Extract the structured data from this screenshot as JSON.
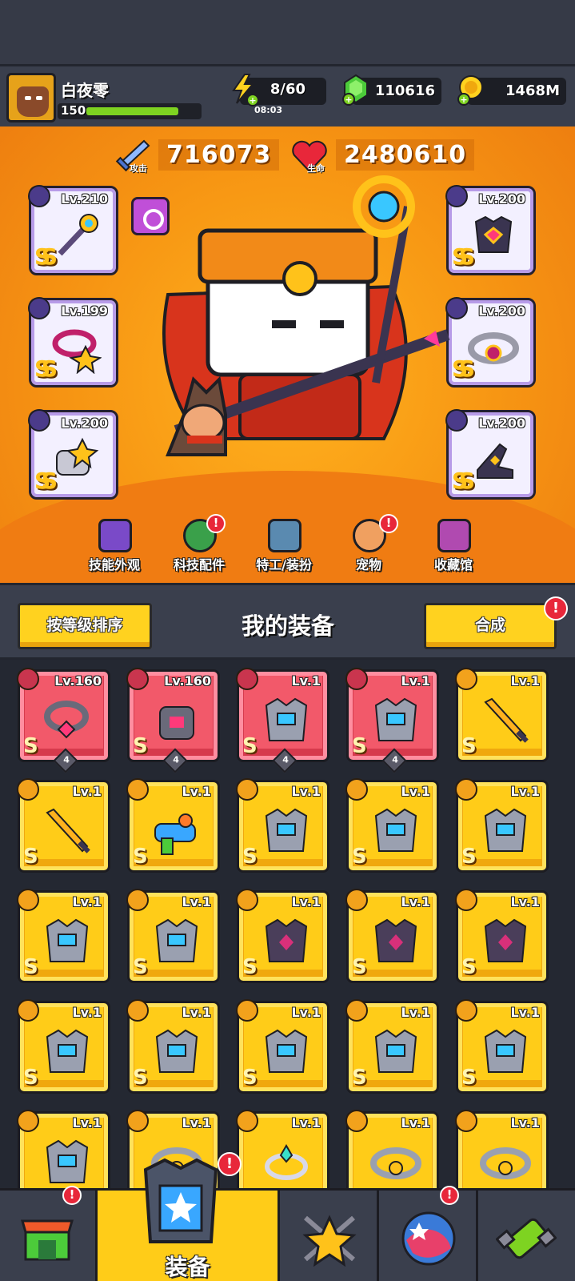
{
  "player": {
    "name": "白夜零",
    "level": "150",
    "xp_fraction": 0.82
  },
  "resources": {
    "energy": "8/60",
    "energy_timer": "08:03",
    "gems": "110616",
    "coins": "1468M"
  },
  "stats": {
    "attack_value": "716073",
    "attack_label": "攻击",
    "hp_value": "2480610",
    "hp_label": "生命"
  },
  "equipped": {
    "left": [
      {
        "level": "Lv.210",
        "rank": "SS",
        "icon": "staff-icon"
      },
      {
        "level": "Lv.199",
        "rank": "SS",
        "icon": "necklace-icon"
      },
      {
        "level": "Lv.200",
        "rank": "SS",
        "icon": "glove-icon"
      }
    ],
    "right": [
      {
        "level": "Lv.200",
        "rank": "SS",
        "icon": "armor-icon"
      },
      {
        "level": "Lv.200",
        "rank": "SS",
        "icon": "belt-icon"
      },
      {
        "level": "Lv.200",
        "rank": "SS",
        "icon": "boots-icon"
      }
    ]
  },
  "features": [
    {
      "label": "技能外观",
      "icon": "skill-skin-icon",
      "alert": false
    },
    {
      "label": "科技配件",
      "icon": "tech-part-icon",
      "alert": true
    },
    {
      "label": "特工/装扮",
      "icon": "agent-icon",
      "alert": false
    },
    {
      "label": "宠物",
      "icon": "pet-icon",
      "alert": true
    },
    {
      "label": "收藏馆",
      "icon": "collection-icon",
      "alert": false
    }
  ],
  "section": {
    "sort_label": "按等级排序",
    "title": "我的装备",
    "merge_label": "合成",
    "alert": "!"
  },
  "inventory": [
    {
      "level": "Lv.160",
      "rank": "S",
      "tier": "red",
      "stars": "4",
      "icon": "necklace-icon"
    },
    {
      "level": "Lv.160",
      "rank": "S",
      "tier": "red",
      "stars": "4",
      "icon": "glove-icon"
    },
    {
      "level": "Lv.1",
      "rank": "S",
      "tier": "red",
      "stars": "4",
      "icon": "armor-icon"
    },
    {
      "level": "Lv.1",
      "rank": "S",
      "tier": "red",
      "stars": "4",
      "icon": "armor-icon"
    },
    {
      "level": "Lv.1",
      "rank": "S",
      "tier": "gold",
      "stars": "",
      "icon": "sword-icon"
    },
    {
      "level": "Lv.1",
      "rank": "S",
      "tier": "gold",
      "stars": "",
      "icon": "sword-icon"
    },
    {
      "level": "Lv.1",
      "rank": "S",
      "tier": "gold",
      "stars": "",
      "icon": "water-gun-icon"
    },
    {
      "level": "Lv.1",
      "rank": "S",
      "tier": "gold",
      "stars": "",
      "icon": "armor-icon"
    },
    {
      "level": "Lv.1",
      "rank": "S",
      "tier": "gold",
      "stars": "",
      "icon": "armor-icon"
    },
    {
      "level": "Lv.1",
      "rank": "S",
      "tier": "gold",
      "stars": "",
      "icon": "armor-icon"
    },
    {
      "level": "Lv.1",
      "rank": "S",
      "tier": "gold",
      "stars": "",
      "icon": "armor-icon"
    },
    {
      "level": "Lv.1",
      "rank": "S",
      "tier": "gold",
      "stars": "",
      "icon": "armor-icon"
    },
    {
      "level": "Lv.1",
      "rank": "S",
      "tier": "gold",
      "stars": "",
      "icon": "dark-armor-icon"
    },
    {
      "level": "Lv.1",
      "rank": "S",
      "tier": "gold",
      "stars": "",
      "icon": "dark-armor-icon"
    },
    {
      "level": "Lv.1",
      "rank": "S",
      "tier": "gold",
      "stars": "",
      "icon": "dark-armor-icon"
    },
    {
      "level": "Lv.1",
      "rank": "S",
      "tier": "gold",
      "stars": "",
      "icon": "armor-icon"
    },
    {
      "level": "Lv.1",
      "rank": "S",
      "tier": "gold",
      "stars": "",
      "icon": "armor-icon"
    },
    {
      "level": "Lv.1",
      "rank": "S",
      "tier": "gold",
      "stars": "",
      "icon": "armor-icon"
    },
    {
      "level": "Lv.1",
      "rank": "S",
      "tier": "gold",
      "stars": "",
      "icon": "armor-icon"
    },
    {
      "level": "Lv.1",
      "rank": "S",
      "tier": "gold",
      "stars": "",
      "icon": "armor-icon"
    },
    {
      "level": "Lv.1",
      "rank": "",
      "tier": "gold",
      "stars": "",
      "icon": "armor-icon"
    },
    {
      "level": "Lv.1",
      "rank": "",
      "tier": "gold",
      "stars": "",
      "icon": "belt-icon"
    },
    {
      "level": "Lv.1",
      "rank": "",
      "tier": "gold",
      "stars": "",
      "icon": "ring-icon"
    },
    {
      "level": "Lv.1",
      "rank": "",
      "tier": "gold",
      "stars": "",
      "icon": "belt-icon"
    },
    {
      "level": "Lv.1",
      "rank": "",
      "tier": "gold",
      "stars": "",
      "icon": "belt-icon"
    }
  ],
  "nav": {
    "tabs": [
      {
        "label": "",
        "icon": "shop-icon",
        "alert": true
      },
      {
        "label": "装备",
        "icon": "equipment-icon",
        "alert": true,
        "active": true
      },
      {
        "label": "",
        "icon": "talent-star-icon",
        "alert": false
      },
      {
        "label": "",
        "icon": "world-map-icon",
        "alert": true
      },
      {
        "label": "",
        "icon": "evolution-icon",
        "alert": false
      }
    ]
  },
  "colors": {
    "hero_bg": "#f79613",
    "card_gold": "#ffcc18",
    "card_red": "#f2596a",
    "panel": "#3a3f4d",
    "alert": "#e8273a"
  }
}
